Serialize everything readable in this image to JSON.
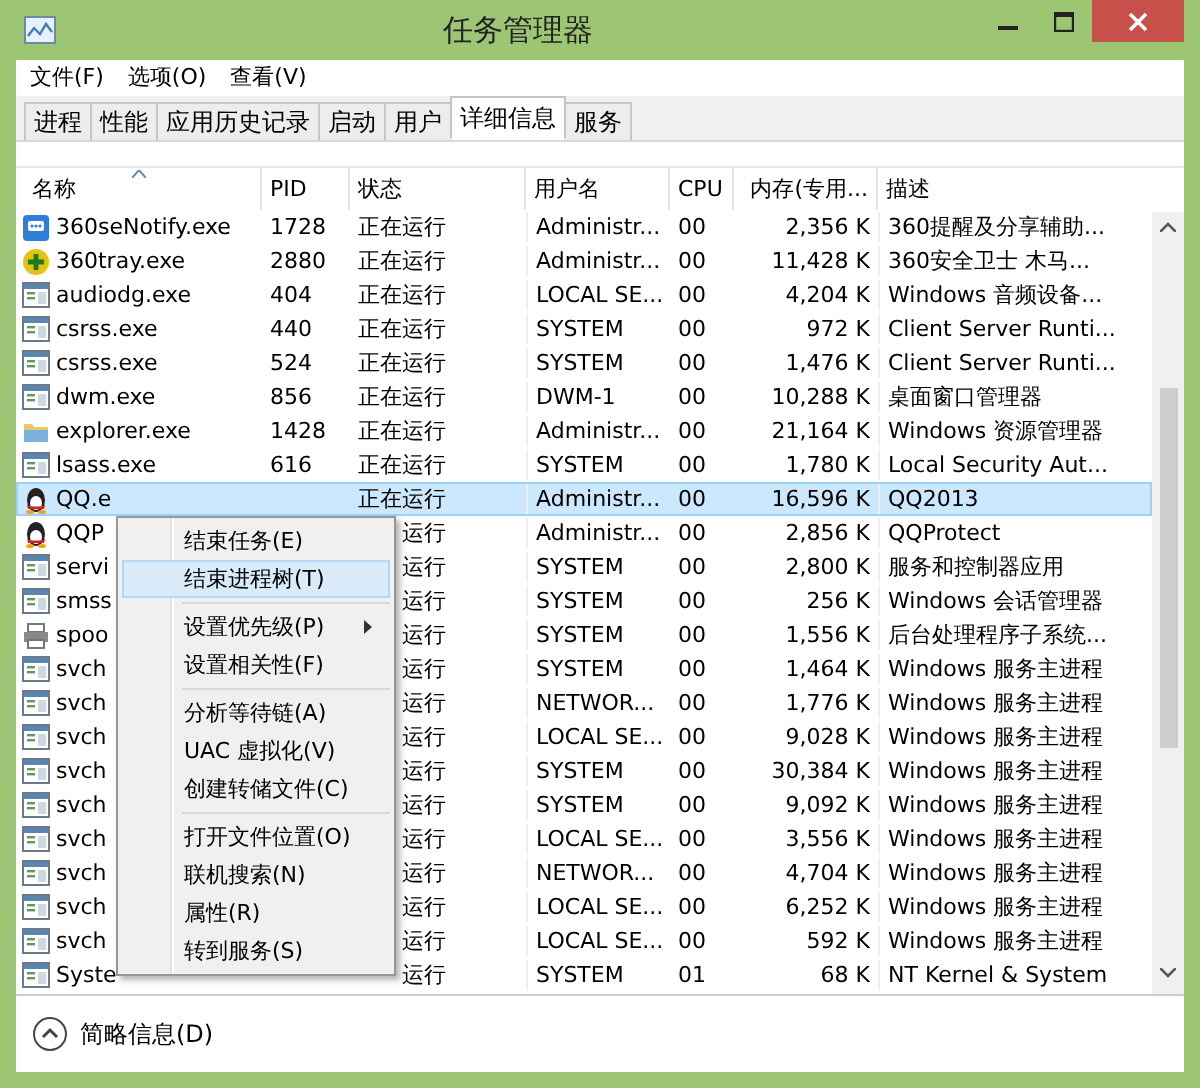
{
  "window": {
    "title": "任务管理器"
  },
  "menu_bar": [
    "文件(F)",
    "选项(O)",
    "查看(V)"
  ],
  "tabs": [
    {
      "label": "进程",
      "selected": false
    },
    {
      "label": "性能",
      "selected": false
    },
    {
      "label": "应用历史记录",
      "selected": false
    },
    {
      "label": "启动",
      "selected": false
    },
    {
      "label": "用户",
      "selected": false
    },
    {
      "label": "详细信息",
      "selected": true
    },
    {
      "label": "服务",
      "selected": false
    }
  ],
  "table": {
    "columns": [
      "名称",
      "PID",
      "状态",
      "用户名",
      "CPU",
      "内存(专用...",
      "描述"
    ],
    "rows": [
      {
        "kind": "notify",
        "name": "360seNotify.exe",
        "pid": "1728",
        "status": "正在运行",
        "user": "Administr...",
        "cpu": "00",
        "memory": "2,356 K",
        "description": "360提醒及分享辅助...",
        "selected": false
      },
      {
        "kind": "shield",
        "name": "360tray.exe",
        "pid": "2880",
        "status": "正在运行",
        "user": "Administr...",
        "cpu": "00",
        "memory": "11,428 K",
        "description": "360安全卫士 木马...",
        "selected": false
      },
      {
        "kind": "app",
        "name": "audiodg.exe",
        "pid": "404",
        "status": "正在运行",
        "user": "LOCAL SE...",
        "cpu": "00",
        "memory": "4,204 K",
        "description": "Windows 音频设备...",
        "selected": false
      },
      {
        "kind": "app",
        "name": "csrss.exe",
        "pid": "440",
        "status": "正在运行",
        "user": "SYSTEM",
        "cpu": "00",
        "memory": "972 K",
        "description": "Client Server Runti...",
        "selected": false
      },
      {
        "kind": "app",
        "name": "csrss.exe",
        "pid": "524",
        "status": "正在运行",
        "user": "SYSTEM",
        "cpu": "00",
        "memory": "1,476 K",
        "description": "Client Server Runti...",
        "selected": false
      },
      {
        "kind": "app",
        "name": "dwm.exe",
        "pid": "856",
        "status": "正在运行",
        "user": "DWM-1",
        "cpu": "00",
        "memory": "10,288 K",
        "description": "桌面窗口管理器",
        "selected": false
      },
      {
        "kind": "folder",
        "name": "explorer.exe",
        "pid": "1428",
        "status": "正在运行",
        "user": "Administr...",
        "cpu": "00",
        "memory": "21,164 K",
        "description": "Windows 资源管理器",
        "selected": false
      },
      {
        "kind": "app",
        "name": "lsass.exe",
        "pid": "616",
        "status": "正在运行",
        "user": "SYSTEM",
        "cpu": "00",
        "memory": "1,780 K",
        "description": "Local Security Aut...",
        "selected": false
      },
      {
        "kind": "penguin",
        "name": "QQ.e",
        "status": "正在运行",
        "user": "Administr...",
        "cpu": "00",
        "memory": "16,596 K",
        "description": "QQ2013",
        "selected": true
      },
      {
        "kind": "penguin",
        "name": "QQP",
        "status": "运行",
        "user": "Administr...",
        "cpu": "00",
        "memory": "2,856 K",
        "description": "QQProtect",
        "selected": false
      },
      {
        "kind": "app",
        "name": "servi",
        "status": "运行",
        "user": "SYSTEM",
        "cpu": "00",
        "memory": "2,800 K",
        "description": "服务和控制器应用",
        "selected": false
      },
      {
        "kind": "app",
        "name": "smss",
        "status": "运行",
        "user": "SYSTEM",
        "cpu": "00",
        "memory": "256 K",
        "description": "Windows 会话管理器",
        "selected": false
      },
      {
        "kind": "printer",
        "name": "spoo",
        "status": "运行",
        "user": "SYSTEM",
        "cpu": "00",
        "memory": "1,556 K",
        "description": "后台处理程序子系统...",
        "selected": false
      },
      {
        "kind": "app",
        "name": "svch",
        "status": "运行",
        "user": "SYSTEM",
        "cpu": "00",
        "memory": "1,464 K",
        "description": "Windows 服务主进程",
        "selected": false
      },
      {
        "kind": "app",
        "name": "svch",
        "status": "运行",
        "user": "NETWOR...",
        "cpu": "00",
        "memory": "1,776 K",
        "description": "Windows 服务主进程",
        "selected": false
      },
      {
        "kind": "app",
        "name": "svch",
        "status": "运行",
        "user": "LOCAL SE...",
        "cpu": "00",
        "memory": "9,028 K",
        "description": "Windows 服务主进程",
        "selected": false
      },
      {
        "kind": "app",
        "name": "svch",
        "status": "运行",
        "user": "SYSTEM",
        "cpu": "00",
        "memory": "30,384 K",
        "description": "Windows 服务主进程",
        "selected": false
      },
      {
        "kind": "app",
        "name": "svch",
        "status": "运行",
        "user": "SYSTEM",
        "cpu": "00",
        "memory": "9,092 K",
        "description": "Windows 服务主进程",
        "selected": false
      },
      {
        "kind": "app",
        "name": "svch",
        "status": "运行",
        "user": "LOCAL SE...",
        "cpu": "00",
        "memory": "3,556 K",
        "description": "Windows 服务主进程",
        "selected": false
      },
      {
        "kind": "app",
        "name": "svch",
        "status": "运行",
        "user": "NETWOR...",
        "cpu": "00",
        "memory": "4,704 K",
        "description": "Windows 服务主进程",
        "selected": false
      },
      {
        "kind": "app",
        "name": "svch",
        "status": "运行",
        "user": "LOCAL SE...",
        "cpu": "00",
        "memory": "6,252 K",
        "description": "Windows 服务主进程",
        "selected": false
      },
      {
        "kind": "app",
        "name": "svch",
        "status": "运行",
        "user": "LOCAL SE...",
        "cpu": "00",
        "memory": "592 K",
        "description": "Windows 服务主进程",
        "selected": false
      },
      {
        "kind": "app",
        "name": "Syste",
        "status": "运行",
        "user": "SYSTEM",
        "cpu": "01",
        "memory": "68 K",
        "description": "NT Kernel & System",
        "selected": false
      }
    ]
  },
  "context_menu": {
    "groups": [
      [
        {
          "label": "结束任务(E)",
          "selected": false,
          "submenu": false
        },
        {
          "label": "结束进程树(T)",
          "selected": true,
          "submenu": false
        }
      ],
      [
        {
          "label": "设置优先级(P)",
          "selected": false,
          "submenu": true
        },
        {
          "label": "设置相关性(F)",
          "selected": false,
          "submenu": false
        }
      ],
      [
        {
          "label": "分析等待链(A)",
          "selected": false,
          "submenu": false
        },
        {
          "label": "UAC 虚拟化(V)",
          "selected": false,
          "submenu": false
        },
        {
          "label": "创建转储文件(C)",
          "selected": false,
          "submenu": false
        }
      ],
      [
        {
          "label": "打开文件位置(O)",
          "selected": false,
          "submenu": false
        },
        {
          "label": "联机搜索(N)",
          "selected": false,
          "submenu": false
        },
        {
          "label": "属性(R)",
          "selected": false,
          "submenu": false
        },
        {
          "label": "转到服务(S)",
          "selected": false,
          "submenu": false
        }
      ]
    ]
  },
  "footer": {
    "label": "简略信息(D)"
  }
}
